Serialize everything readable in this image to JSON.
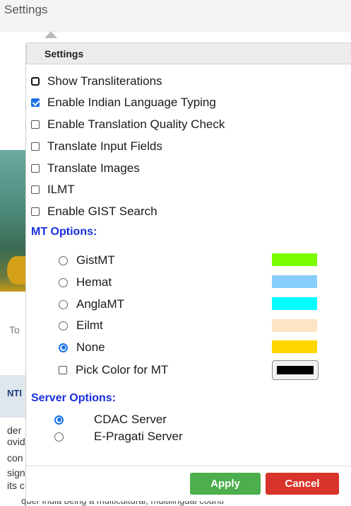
{
  "topbar": {
    "title": "Settings"
  },
  "background": {
    "to_text": "To",
    "band_text": "NTI",
    "lines": [
      "der",
      "ovid",
      "con",
      "sign",
      "its c"
    ],
    "bottom_line": "quer  india  being  a  multicultural,  multilingual  countr"
  },
  "panel": {
    "header": "Settings",
    "options": [
      {
        "label": "Show Transliterations",
        "checked": false
      },
      {
        "label": "Enable Indian Language Typing",
        "checked": true
      },
      {
        "label": "Enable Translation Quality Check",
        "checked": false
      },
      {
        "label": "Translate Input Fields",
        "checked": false
      },
      {
        "label": "Translate Images",
        "checked": false
      },
      {
        "label": "ILMT",
        "checked": false
      },
      {
        "label": "Enable GIST Search",
        "checked": false
      }
    ],
    "mt_title": "MT Options:",
    "mt_options": [
      {
        "label": "GistMT",
        "selected": false,
        "color": "#7cfc00"
      },
      {
        "label": "Hemat",
        "selected": false,
        "color": "#87cefa"
      },
      {
        "label": "AnglaMT",
        "selected": false,
        "color": "#00ffff"
      },
      {
        "label": "Eilmt",
        "selected": false,
        "color": "#ffe4c4"
      },
      {
        "label": "None",
        "selected": true,
        "color": "#ffd700"
      }
    ],
    "pick_color_label": "Pick Color for MT",
    "pick_color_value": "#000000",
    "server_title": "Server Options:",
    "server_options": [
      {
        "label": "CDAC Server",
        "selected": true
      },
      {
        "label": "E-Pragati Server",
        "selected": false
      }
    ],
    "apply_label": "Apply",
    "cancel_label": "Cancel"
  }
}
